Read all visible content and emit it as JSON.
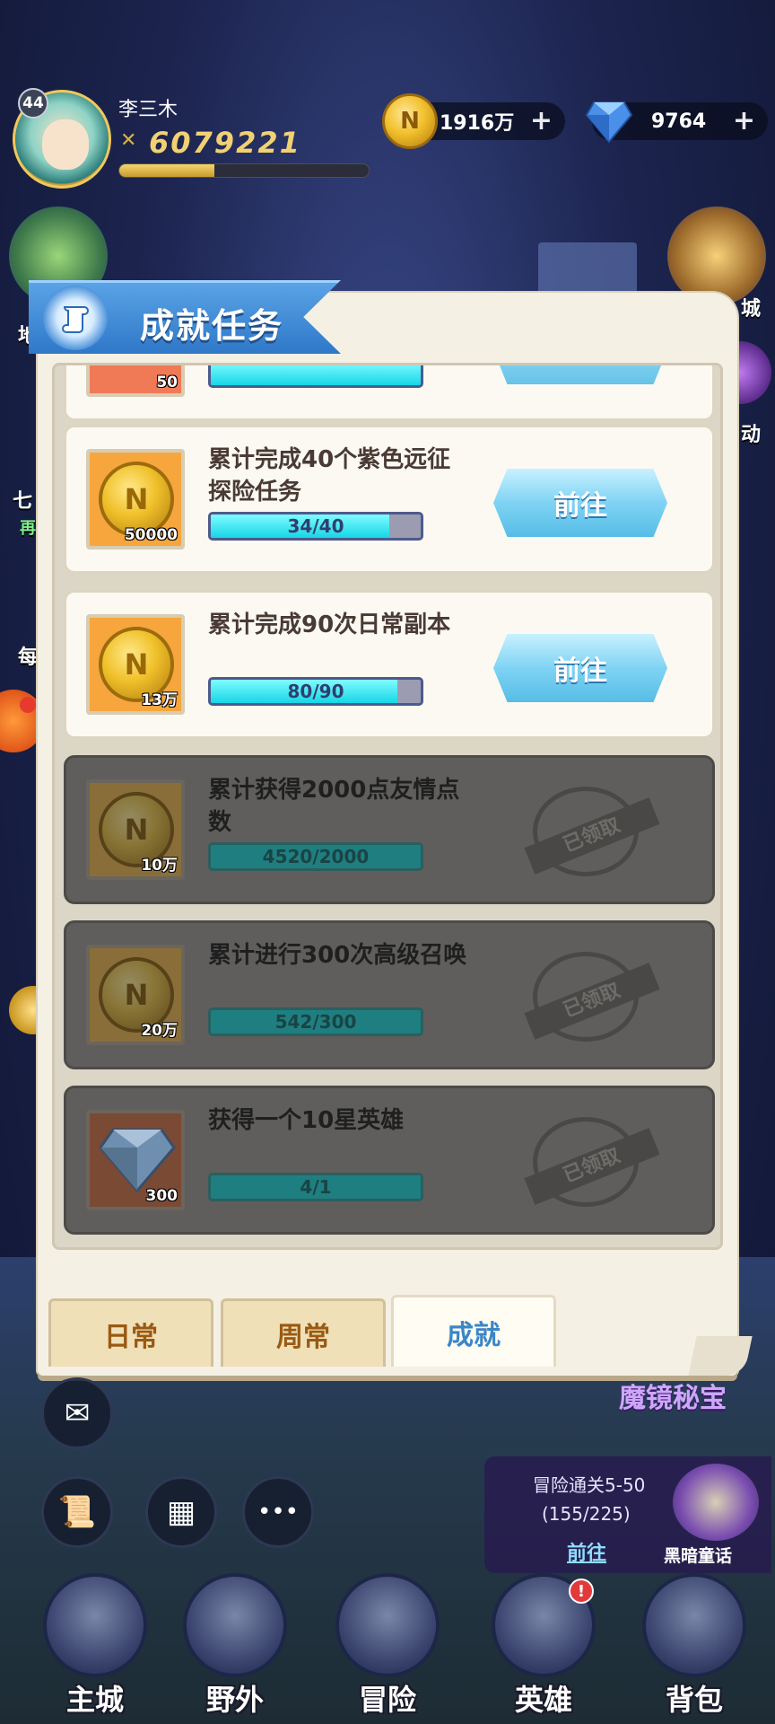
{
  "player": {
    "level": "44",
    "name": "李三木",
    "power": "6079221",
    "exp_fraction": 0.38
  },
  "resources": {
    "coins": "1916万",
    "gems": "9764",
    "plus": "+"
  },
  "side": {
    "right_shop": "城",
    "right_event": "动",
    "left_1": "七",
    "left_2": "再",
    "left_3": "每",
    "left_top": "地"
  },
  "panel": {
    "title": "成就任务",
    "top_item_qty": "50"
  },
  "tasks": [
    {
      "description": "累计完成40个紫色远征探险任务",
      "reward_qty": "50000",
      "progress_text": "34/40",
      "progress": 0.85,
      "action": "前往",
      "claimed": false
    },
    {
      "description": "累计完成90次日常副本",
      "reward_qty": "13万",
      "progress_text": "80/90",
      "progress": 0.89,
      "action": "前往",
      "claimed": false
    },
    {
      "description": "累计获得2000点友情点数",
      "reward_qty": "10万",
      "progress_text": "4520/2000",
      "progress": 1.0,
      "action": "已领取",
      "claimed": true
    },
    {
      "description": "累计进行300次高级召唤",
      "reward_qty": "20万",
      "progress_text": "542/300",
      "progress": 1.0,
      "action": "已领取",
      "claimed": true
    },
    {
      "description": "获得一个10星英雄",
      "reward_qty": "300",
      "progress_text": "4/1",
      "progress": 1.0,
      "action": "已领取",
      "claimed": true
    }
  ],
  "tabs": [
    "日常",
    "周常",
    "成就"
  ],
  "active_tab": "成就",
  "quest_tracker": {
    "title": "冒险通关5-50",
    "progress": "(155/225)",
    "go_label": "前往",
    "book_label": "黑暗童话"
  },
  "banner": "魔镜秘宝",
  "more_button": "•••",
  "bottom_nav": [
    {
      "label": "主城",
      "badge": ""
    },
    {
      "label": "野外",
      "badge": ""
    },
    {
      "label": "冒险",
      "badge": ""
    },
    {
      "label": "英雄",
      "badge": "!"
    },
    {
      "label": "背包",
      "badge": ""
    }
  ],
  "colors": {
    "ribbon_blue": "#2f78c8",
    "progress_cyan": "#17d6e6",
    "go_button": "#7fd3f4",
    "claimed_gray": "#5f5e5c"
  }
}
